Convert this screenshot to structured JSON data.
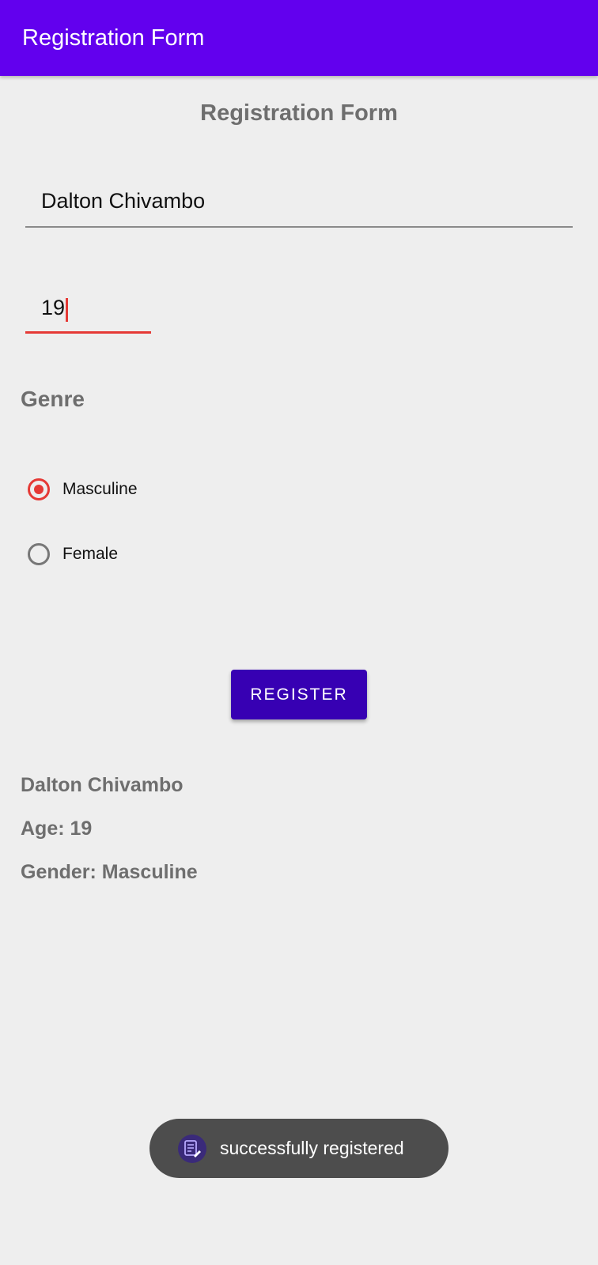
{
  "app_bar": {
    "title": "Registration Form",
    "color": "#6200ee"
  },
  "form": {
    "heading": "Registration Form",
    "name_value": "Dalton Chivambo",
    "age_value": "19",
    "gender_label": "Genre",
    "gender_options": [
      {
        "label": "Masculine",
        "checked": true
      },
      {
        "label": "Female",
        "checked": false
      }
    ],
    "register_label": "REGISTER",
    "accent_color": "#e53935",
    "button_color": "#3700b3"
  },
  "result": {
    "name": "Dalton Chivambo",
    "age": "Age: 19",
    "gender": "Gender: Masculine"
  },
  "toast": {
    "message": "successfully registered",
    "icon": "app-form-icon"
  }
}
